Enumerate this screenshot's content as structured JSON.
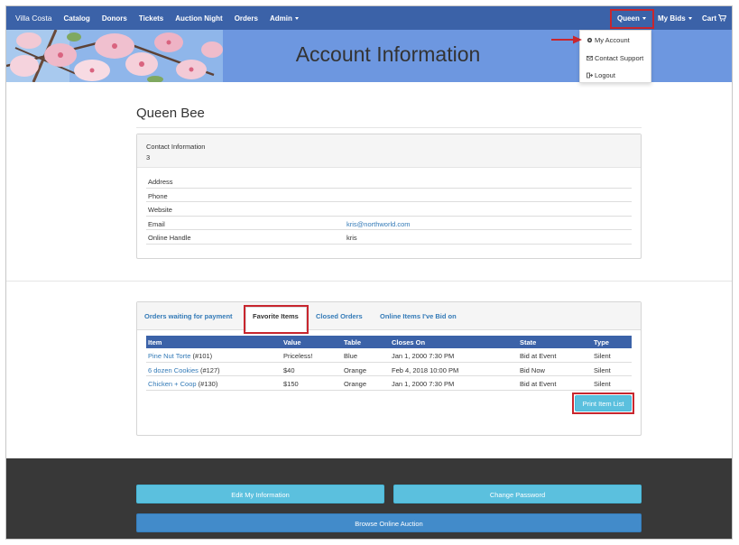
{
  "navbar": {
    "brand": "Villa Costa",
    "items": [
      "Catalog",
      "Donors",
      "Tickets",
      "Auction Night",
      "Orders"
    ],
    "admin_label": "Admin",
    "user_label": "Queen",
    "my_bids_label": "My Bids",
    "cart_label": "Cart"
  },
  "banner": {
    "title": "Account Information"
  },
  "user_menu": {
    "items": [
      {
        "label": "My Account",
        "icon": "gear-icon"
      },
      {
        "label": "Contact Support",
        "icon": "envelope-icon"
      },
      {
        "label": "Logout",
        "icon": "logout-icon"
      }
    ]
  },
  "profile": {
    "name": "Queen Bee",
    "contact_title": "Contact Information",
    "contact_number": "3",
    "fields": [
      {
        "label": "Address",
        "value": ""
      },
      {
        "label": "Phone",
        "value": ""
      },
      {
        "label": "Website",
        "value": ""
      },
      {
        "label": "Email",
        "value": "kris@northworld.com"
      },
      {
        "label": "Online Handle",
        "value": "kris"
      }
    ]
  },
  "orders": {
    "tabs": [
      "Orders waiting for payment",
      "Favorite Items",
      "Closed Orders",
      "Online Items I've Bid on"
    ],
    "active_tab": "Favorite Items",
    "columns": [
      "Item",
      "Value",
      "Table",
      "Closes On",
      "State",
      "Type"
    ],
    "rows": [
      {
        "item": "Pine Nut Torte",
        "num": "(#101)",
        "value": "Priceless!",
        "table": "Blue",
        "closes": "Jan 1, 2000 7:30 PM",
        "state": "Bid at Event",
        "type": "Silent"
      },
      {
        "item": "6 dozen Cookies",
        "num": "(#127)",
        "value": "$40",
        "table": "Orange",
        "closes": "Feb 4, 2018 10:00 PM",
        "state": "Bid Now",
        "type": "Silent"
      },
      {
        "item": "Chicken + Coop",
        "num": "(#130)",
        "value": "$150",
        "table": "Orange",
        "closes": "Jan 1, 2000 7:30 PM",
        "state": "Bid at Event",
        "type": "Silent"
      }
    ],
    "print_label": "Print Item List"
  },
  "footer": {
    "edit_label": "Edit My Information",
    "password_label": "Change Password",
    "browse_label": "Browse Online Auction"
  },
  "colors": {
    "navbar": "#3b62a8",
    "banner": "#6d97e0",
    "highlight": "#c8262e",
    "info_button": "#5bc0de",
    "primary_button": "#428bca",
    "footer": "#383838"
  }
}
